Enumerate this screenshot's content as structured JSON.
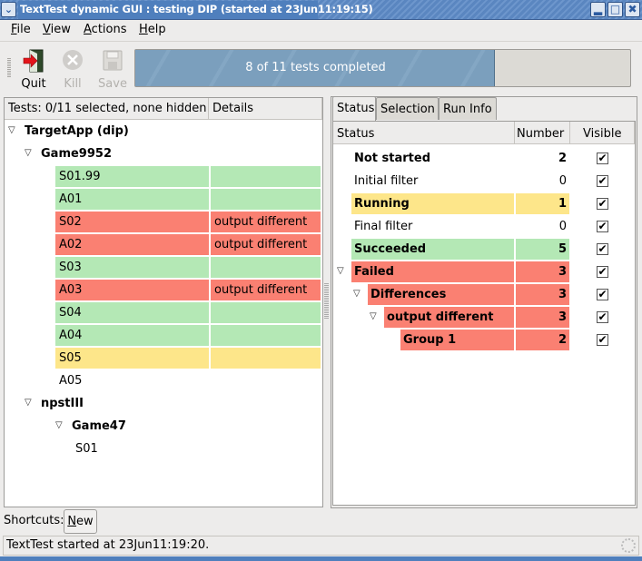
{
  "window": {
    "title": "TextTest dynamic GUI : testing DIP (started at 23Jun11:19:15)",
    "menu_icon": "chevron-down-icon",
    "buttons": {
      "minimize": "minimize-icon",
      "maximize": "maximize-icon",
      "close": "close-icon"
    }
  },
  "menubar": {
    "items": [
      {
        "label": "File",
        "mnemonic": "F"
      },
      {
        "label": "View",
        "mnemonic": "V"
      },
      {
        "label": "Actions",
        "mnemonic": "A"
      },
      {
        "label": "Help",
        "mnemonic": "H"
      }
    ]
  },
  "toolbar": {
    "quit_label": "Quit",
    "kill_label": "Kill",
    "save_label": "Save",
    "progress": {
      "text": "8 of 11 tests completed",
      "completed": 8,
      "total": 11
    }
  },
  "tests_pane": {
    "header_tests": "Tests: 0/11 selected, none hidden",
    "header_details": "Details",
    "rows": [
      {
        "label": "TargetApp (dip)",
        "level": 0,
        "bold": true,
        "expander": true,
        "details": "",
        "state": "none"
      },
      {
        "label": "Game9952",
        "level": 1,
        "bold": true,
        "expander": true,
        "details": "",
        "state": "none"
      },
      {
        "label": "S01.99",
        "level": 2,
        "bold": false,
        "expander": false,
        "details": "",
        "state": "green"
      },
      {
        "label": "A01",
        "level": 2,
        "bold": false,
        "expander": false,
        "details": "",
        "state": "green"
      },
      {
        "label": "S02",
        "level": 2,
        "bold": false,
        "expander": false,
        "details": "output different",
        "state": "red"
      },
      {
        "label": "A02",
        "level": 2,
        "bold": false,
        "expander": false,
        "details": "output different",
        "state": "red"
      },
      {
        "label": "S03",
        "level": 2,
        "bold": false,
        "expander": false,
        "details": "",
        "state": "green"
      },
      {
        "label": "A03",
        "level": 2,
        "bold": false,
        "expander": false,
        "details": "output different",
        "state": "red"
      },
      {
        "label": "S04",
        "level": 2,
        "bold": false,
        "expander": false,
        "details": "",
        "state": "green"
      },
      {
        "label": "A04",
        "level": 2,
        "bold": false,
        "expander": false,
        "details": "",
        "state": "green"
      },
      {
        "label": "S05",
        "level": 2,
        "bold": false,
        "expander": false,
        "details": "",
        "state": "yellow"
      },
      {
        "label": "A05",
        "level": 2,
        "bold": false,
        "expander": false,
        "details": "",
        "state": "none"
      },
      {
        "label": "npstIII",
        "level": 1,
        "bold": true,
        "expander": true,
        "details": "",
        "state": "none"
      },
      {
        "label": "Game47",
        "level": 2,
        "bold": true,
        "expander": true,
        "details": "",
        "state": "none"
      },
      {
        "label": "S01",
        "level": 3,
        "bold": false,
        "expander": false,
        "details": "",
        "state": "none"
      }
    ]
  },
  "right_tabs": [
    {
      "label": "Status",
      "active": true
    },
    {
      "label": "Selection",
      "active": false
    },
    {
      "label": "Run Info",
      "active": false
    }
  ],
  "status_view": {
    "headers": {
      "status": "Status",
      "number": "Number",
      "visible": "Visible"
    },
    "rows": [
      {
        "label": "Not started",
        "number": "2",
        "visible": true,
        "bold": true,
        "level": 0,
        "expander": false,
        "state": "none"
      },
      {
        "label": "Initial filter",
        "number": "0",
        "visible": true,
        "bold": false,
        "level": 0,
        "expander": false,
        "state": "none"
      },
      {
        "label": "Running",
        "number": "1",
        "visible": true,
        "bold": true,
        "level": 0,
        "expander": false,
        "state": "yellow"
      },
      {
        "label": "Final filter",
        "number": "0",
        "visible": true,
        "bold": false,
        "level": 0,
        "expander": false,
        "state": "none"
      },
      {
        "label": "Succeeded",
        "number": "5",
        "visible": true,
        "bold": true,
        "level": 0,
        "expander": false,
        "state": "green"
      },
      {
        "label": "Failed",
        "number": "3",
        "visible": true,
        "bold": true,
        "level": 0,
        "expander": true,
        "state": "red"
      },
      {
        "label": "Differences",
        "number": "3",
        "visible": true,
        "bold": true,
        "level": 1,
        "expander": true,
        "state": "red"
      },
      {
        "label": "output different",
        "number": "3",
        "visible": true,
        "bold": true,
        "level": 2,
        "expander": true,
        "state": "red"
      },
      {
        "label": "Group 1",
        "number": "2",
        "visible": true,
        "bold": true,
        "level": 3,
        "expander": false,
        "state": "red"
      }
    ]
  },
  "shortcuts": {
    "label": "Shortcuts:",
    "new_label": "New"
  },
  "statusbar": {
    "text": "TextTest started at 23Jun11:19:20."
  },
  "colors": {
    "succeeded": "#b4e8b5",
    "failed": "#fa8072",
    "running": "#fde68a",
    "titlebar": "#4f7fbd"
  }
}
